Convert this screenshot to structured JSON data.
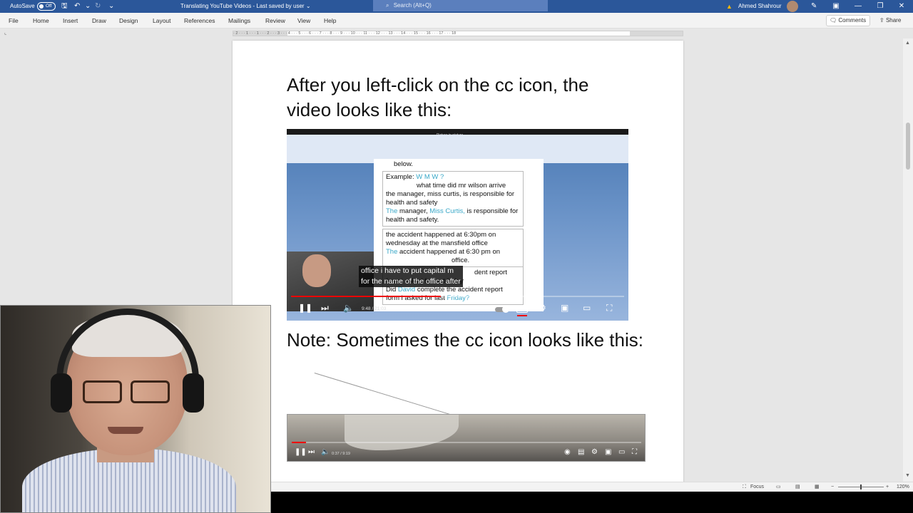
{
  "titlebar": {
    "autosave_label": "AutoSave",
    "autosave_state": "Off",
    "doc_title": "Translating YouTube Videos  -  Last saved by user  ⌄",
    "search_placeholder": "Search (Alt+Q)",
    "user_name": "Ahmed Shahrour"
  },
  "menu": {
    "items": [
      "File",
      "Home",
      "Insert",
      "Draw",
      "Design",
      "Layout",
      "References",
      "Mailings",
      "Review",
      "View",
      "Help"
    ],
    "comments_label": "Comments",
    "share_label": "Share"
  },
  "ruler": {
    "marks": "· 2 · · · 1 · · · 1 · · · 2 · · · 3 · · · 4 · · · 5 · · · 6 · · · 7 · · · 8 · · · 9 · · · 10 · · · 11 · · · 12 · · · 13 · · · 14 · · · 15 · · · 16 · · · 17 · · · 18"
  },
  "document": {
    "text1": "After you left-click on the cc icon, the video looks like this:",
    "text2": "Note: Sometimes the cc icon looks like this:"
  },
  "video1": {
    "pip_label": "Picture in picture",
    "doc_line_below": "below.",
    "example_label": "Example:",
    "example_markers": "W              M   W              ?",
    "line1": "what time did mr wilson arrive",
    "line2": "the manager, miss curtis, is responsible for health and safety",
    "line3_the": "The",
    "line3_mid": " manager, ",
    "line3_name": "Miss Curtis,",
    "line3_end": " is responsible for health and safety.",
    "line4": "the accident happened at 6:30pm on wednesday at the mansfield office",
    "line5_the": "The",
    "line5_end": " accident happened at 6:30 pm on",
    "line5_tail": "office.",
    "line6": "dent report",
    "line7": "form i asked for last friday",
    "line8_did": "Did ",
    "line8_name": "David",
    "line8_end": " complete the accident report",
    "line9": "form i asked for last ",
    "line9_day": "Friday?",
    "caption_line1": "office i have to put capital m",
    "caption_line2": "for the name of the office after",
    "time": "9:48 / 21:03",
    "cc_label": "CC",
    "progress": 0.45
  },
  "video2": {
    "time": "0:37 / 9:19",
    "progress": 0.04
  },
  "statusbar": {
    "focus_label": "Focus",
    "zoom": "120%"
  },
  "colors": {
    "word_blue": "#2b579a",
    "youtube_red": "#e00000",
    "correction_cyan": "#3aa8c8"
  }
}
